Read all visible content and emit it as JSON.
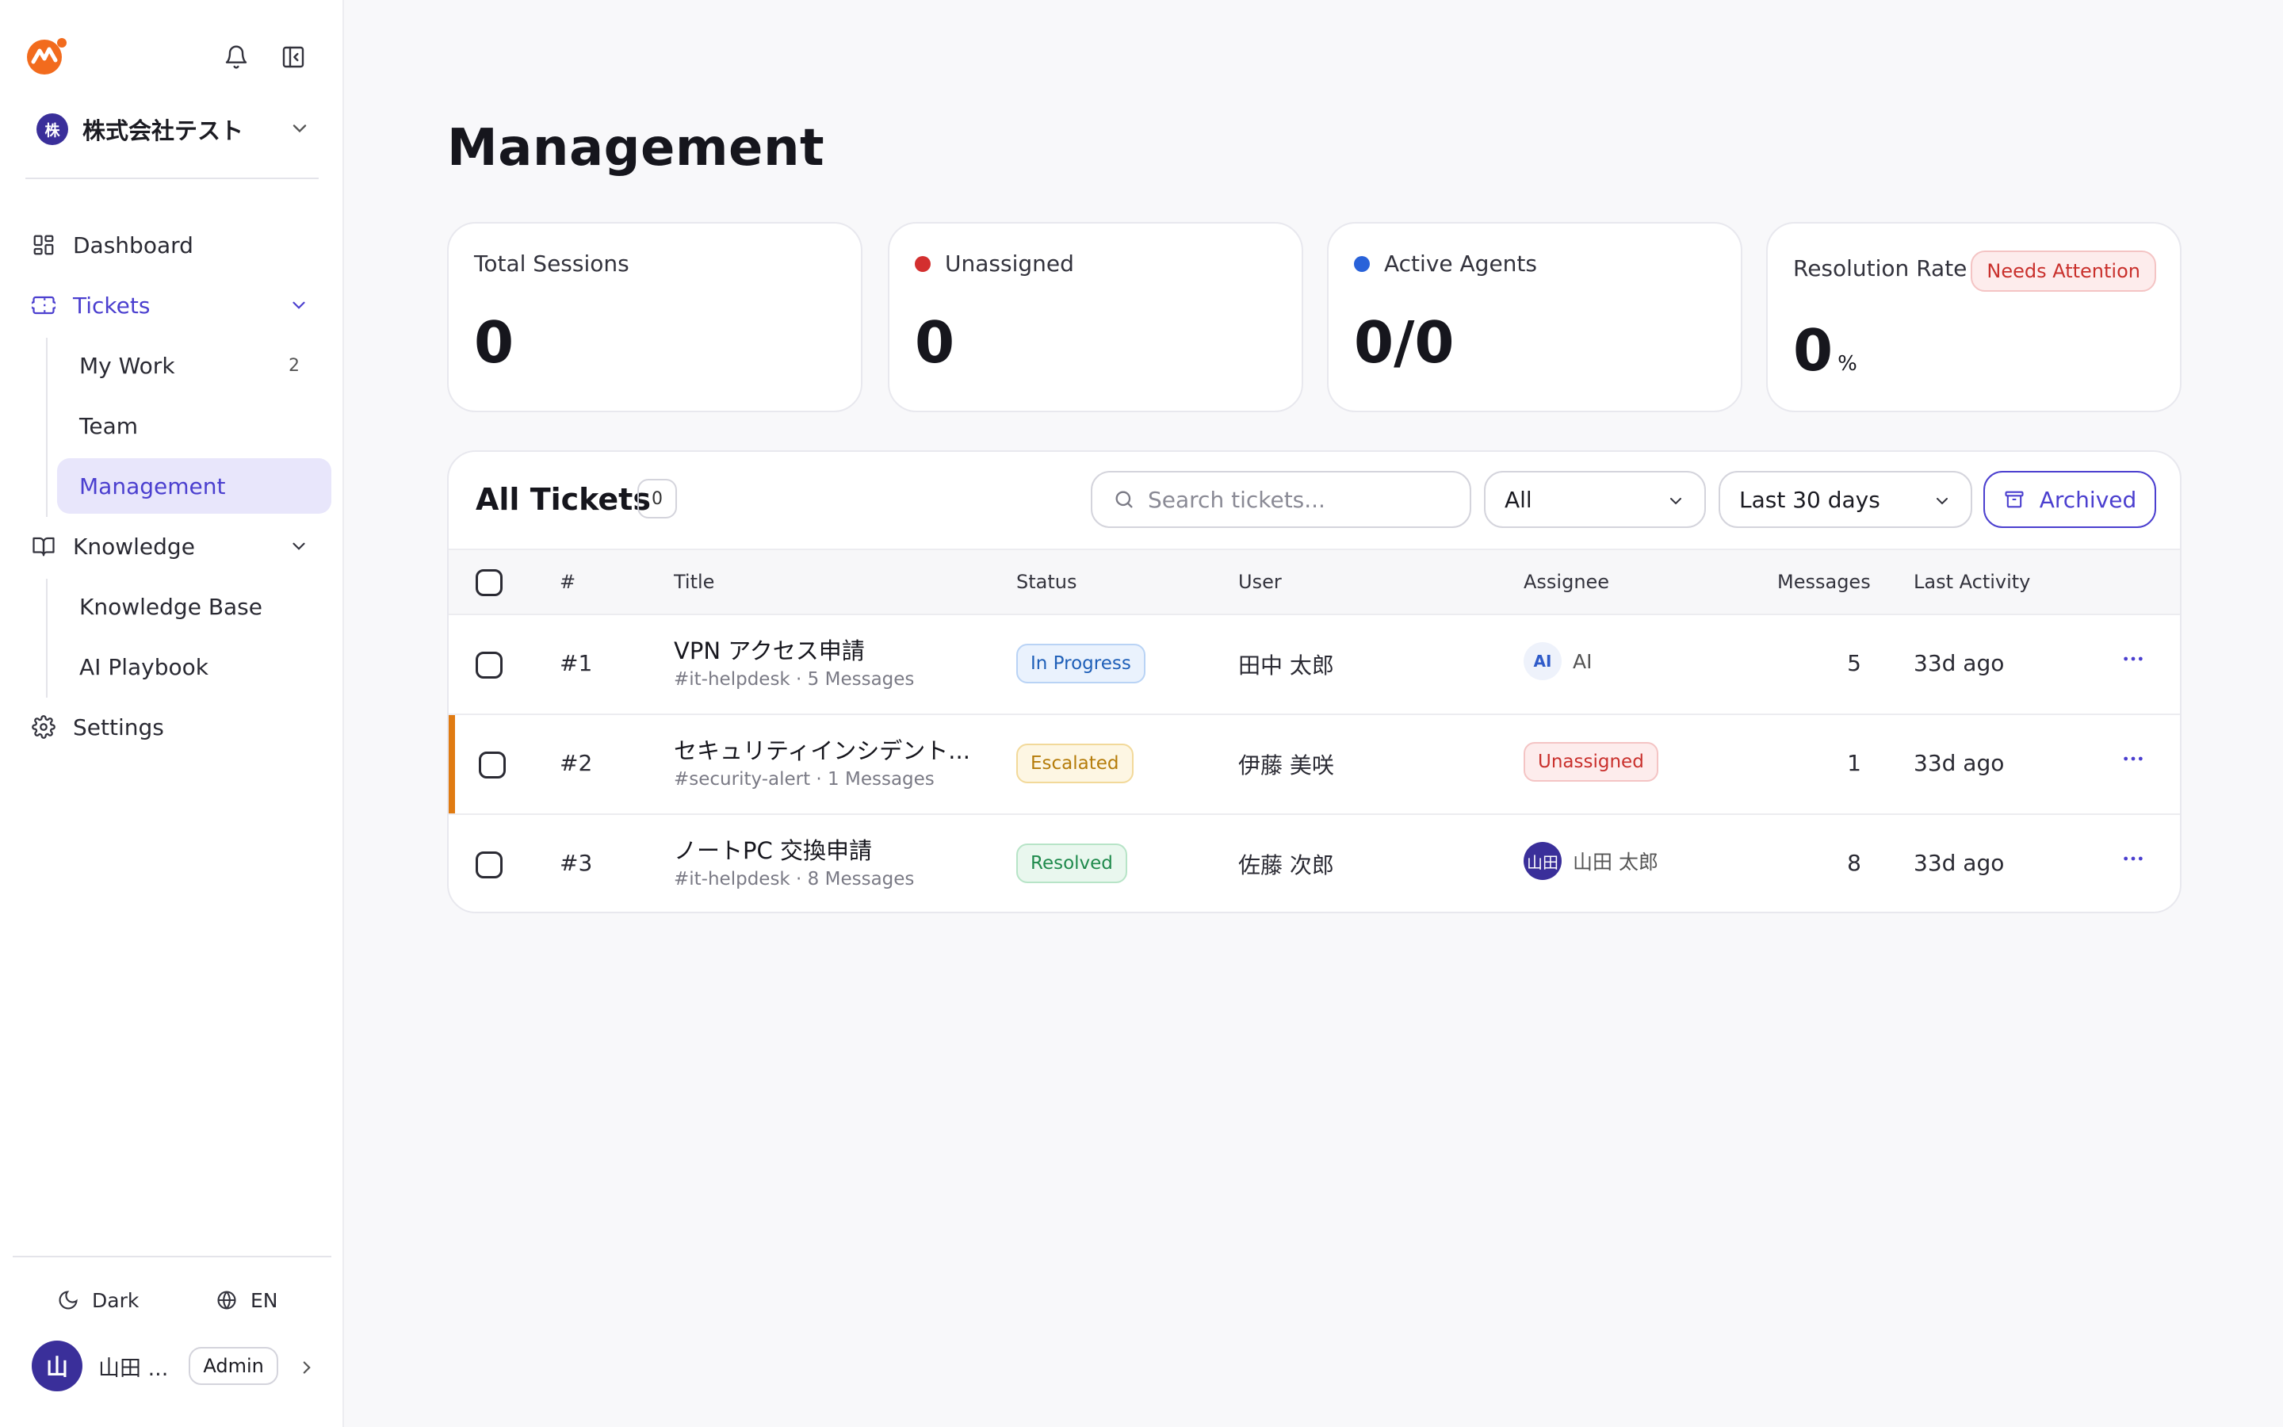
{
  "sidebar": {
    "org": {
      "initial": "株",
      "name": "株式会社テスト"
    },
    "nav": {
      "dashboard": "Dashboard",
      "tickets": "Tickets",
      "my_work": "My Work",
      "my_work_count": "2",
      "team": "Team",
      "management": "Management",
      "knowledge": "Knowledge",
      "knowledge_base": "Knowledge Base",
      "ai_playbook": "AI Playbook",
      "settings": "Settings"
    },
    "footer": {
      "theme": "Dark",
      "language": "EN",
      "user_initial": "山",
      "user_name": "山田 ...",
      "role": "Admin"
    }
  },
  "page": {
    "title": "Management"
  },
  "stats": {
    "total_sessions": {
      "label": "Total Sessions",
      "value": "0"
    },
    "unassigned": {
      "label": "Unassigned",
      "value": "0",
      "color": "#d32f2f"
    },
    "active_agents": {
      "label": "Active Agents",
      "value": "0/0",
      "color": "#2962d9"
    },
    "resolution_rate": {
      "label": "Resolution Rate",
      "value": "0",
      "unit": "%",
      "badge": "Needs Attention"
    }
  },
  "tickets": {
    "title": "All Tickets",
    "count": "0",
    "search_placeholder": "Search tickets...",
    "filter_status": "All",
    "filter_range": "Last 30 days",
    "archived_label": "Archived",
    "columns": {
      "id": "#",
      "title": "Title",
      "status": "Status",
      "user": "User",
      "assignee": "Assignee",
      "messages": "Messages",
      "last_activity": "Last Activity"
    },
    "rows": [
      {
        "id": "#1",
        "title": "VPN アクセス申請",
        "meta": "#it-helpdesk · 5 Messages",
        "status": "In Progress",
        "user": "田中 太郎",
        "assignee_avatar": "AI",
        "assignee": "AI",
        "messages": "5",
        "last_activity": "33d ago"
      },
      {
        "id": "#2",
        "title": "セキュリティインシデント...",
        "meta": "#security-alert · 1 Messages",
        "status": "Escalated",
        "user": "伊藤 美咲",
        "assignee": "Unassigned",
        "messages": "1",
        "last_activity": "33d ago"
      },
      {
        "id": "#3",
        "title": "ノートPC 交換申請",
        "meta": "#it-helpdesk · 8 Messages",
        "status": "Resolved",
        "user": "佐藤 次郎",
        "assignee_avatar": "山田",
        "assignee": "山田 太郎",
        "messages": "8",
        "last_activity": "33d ago"
      }
    ]
  },
  "colors": {
    "accent": "#4b3fcf",
    "logo": "#f26b1d",
    "escalation_bar": "#e07b12"
  }
}
